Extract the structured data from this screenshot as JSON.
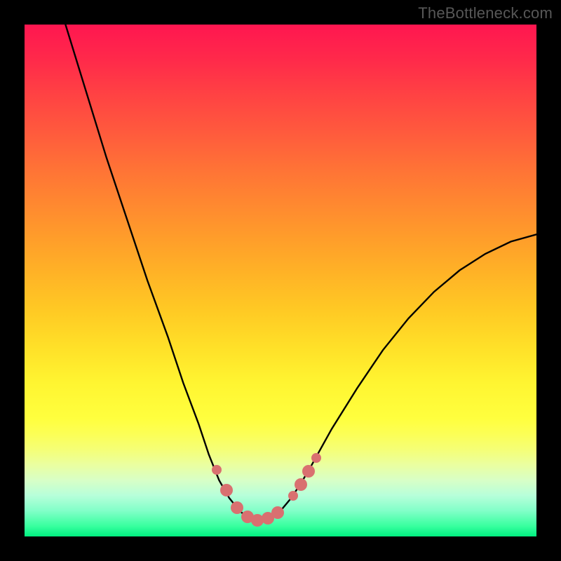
{
  "watermark": "TheBottleneck.com",
  "chart_data": {
    "type": "line",
    "title": "",
    "xlabel": "",
    "ylabel": "",
    "xlim": [
      0,
      100
    ],
    "ylim": [
      0,
      100
    ],
    "grid": false,
    "legend": false,
    "series": [
      {
        "name": "curve",
        "x": [
          8,
          12,
          16,
          20,
          24,
          28,
          31,
          34,
          36,
          38,
          40,
          42,
          43.5,
          45,
          46.5,
          48,
          50,
          52,
          54,
          56,
          60,
          65,
          70,
          75,
          80,
          85,
          90,
          95,
          100
        ],
        "y": [
          100,
          87,
          74,
          62,
          50,
          39,
          30,
          22,
          16,
          11,
          7.5,
          5,
          3.8,
          3.2,
          3.2,
          3.7,
          5,
          7.4,
          10.4,
          13.8,
          21,
          29,
          36.4,
          42.6,
          47.8,
          52,
          55.2,
          57.6,
          59
        ]
      }
    ],
    "markers": {
      "name": "highlight-points",
      "color": "#d97070",
      "points": [
        {
          "x": 37.5,
          "y": 13,
          "size": "small"
        },
        {
          "x": 39.5,
          "y": 9,
          "size": "big"
        },
        {
          "x": 41.5,
          "y": 5.6,
          "size": "big"
        },
        {
          "x": 43.5,
          "y": 3.9,
          "size": "big"
        },
        {
          "x": 45.5,
          "y": 3.2,
          "size": "big"
        },
        {
          "x": 47.5,
          "y": 3.5,
          "size": "big"
        },
        {
          "x": 49.5,
          "y": 4.7,
          "size": "big"
        },
        {
          "x": 52.5,
          "y": 8,
          "size": "small"
        },
        {
          "x": 54,
          "y": 10.2,
          "size": "big"
        },
        {
          "x": 55.5,
          "y": 12.8,
          "size": "big"
        },
        {
          "x": 57,
          "y": 15.3,
          "size": "small"
        }
      ]
    },
    "background_gradient": {
      "top": "#ff1650",
      "mid": "#ffe028",
      "bottom": "#00ef80"
    }
  }
}
